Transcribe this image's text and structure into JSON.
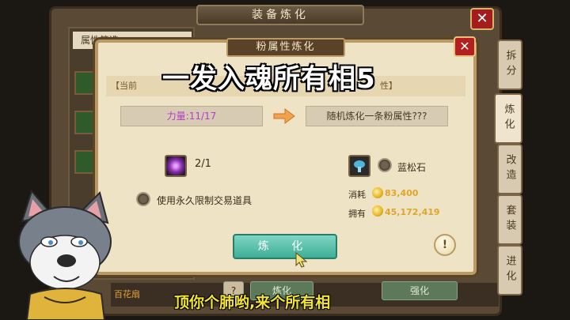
{
  "background_window": {
    "title": "装备炼化",
    "close": "✕",
    "filter_label": "属性筛选",
    "bottom_item": "百花扇",
    "bottom_buttons": [
      "炼化",
      "强化"
    ],
    "help": "?"
  },
  "side_tabs": [
    {
      "label": "拆分",
      "active": false
    },
    {
      "label": "炼化",
      "active": true
    },
    {
      "label": "改造",
      "active": false
    },
    {
      "label": "套装",
      "active": false
    },
    {
      "label": "进化",
      "active": false
    }
  ],
  "modal": {
    "title": "粉属性炼化",
    "close": "✕",
    "info_left": "【当前",
    "info_right": "性】",
    "current_attr": "力量:11/17",
    "target_attr": "随机炼化一条粉属性???",
    "gem_count": "2/1",
    "stone_name": "蓝松石",
    "use_bound_label": "使用永久限制交易道具",
    "cost_label": "消耗",
    "cost_value": "83,400",
    "own_label": "拥有",
    "own_value": "45,172,419",
    "refine_button": "炼 化",
    "help": "!"
  },
  "overlay": {
    "title_text": "一发入魂所有相5",
    "subtitle_text": "顶你个肺哟,来个所有相"
  },
  "colors": {
    "pink_attr": "#b43cc8",
    "gold": "#e0a62c",
    "subtitle_yellow": "#f4e52a",
    "refine_button": "#3fae96"
  }
}
